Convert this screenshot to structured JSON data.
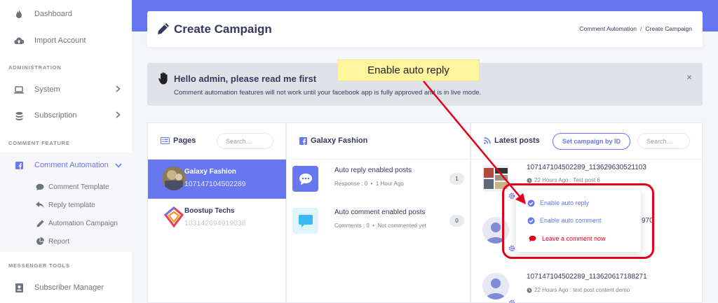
{
  "sidebar": {
    "items": [
      {
        "label": "Dashboard"
      },
      {
        "label": "Import Account"
      }
    ],
    "admin_header": "ADMINISTRATION",
    "admin_items": [
      {
        "label": "System"
      },
      {
        "label": "Subscription"
      }
    ],
    "comment_header": "COMMENT FEATURE",
    "comment_item": {
      "label": "Comment Automation"
    },
    "sub_items": [
      {
        "label": "Comment Template",
        "icon": "comment-icon"
      },
      {
        "label": "Reply template",
        "icon": "reply-icon"
      },
      {
        "label": "Automation Campaign",
        "icon": "pencil-icon"
      },
      {
        "label": "Report",
        "icon": "pie-chart-icon"
      }
    ],
    "messenger_header": "MESSENGER TOOLS",
    "messenger_items": [
      {
        "label": "Subscriber Manager"
      }
    ]
  },
  "header": {
    "title": "Create Campaign",
    "breadcrumb": [
      "Comment Automation",
      "Create Campaign"
    ],
    "breadcrumb_sep": "/"
  },
  "alert": {
    "title": "Hello admin, please read me first",
    "text": "Comment automation features will not work until your facebook app is fully approved and is in live mode.",
    "close": "×"
  },
  "callout": {
    "text": "Enable auto reply"
  },
  "pages_panel": {
    "title": "Pages",
    "search_placeholder": "Search...",
    "pages": [
      {
        "name": "Galaxy Fashion",
        "id": "107147104502289"
      },
      {
        "name": "Boostup Techs",
        "id": "103142694919038"
      }
    ]
  },
  "page_panel": {
    "title": "Galaxy Fashion",
    "items": [
      {
        "title": "Auto reply enabled posts",
        "meta_label": "Response : 0",
        "meta_time": "1 Hour Ago",
        "count": "1"
      },
      {
        "title": "Auto comment enabled posts",
        "meta_label": "Comments : 0",
        "meta_time": "Not commented yet",
        "count": "0"
      }
    ]
  },
  "posts_panel": {
    "title": "Latest posts",
    "button": "Set campaign by ID",
    "search_placeholder": "Search...",
    "posts": [
      {
        "id": "107147104502289_113629630521103",
        "time": "22 Hours Ago",
        "content": "Test post 6"
      },
      {
        "id_suffix": "970"
      },
      {
        "id": "107147104502289_113620617188271",
        "time": "22 Hours Ago",
        "content": "text post content demo"
      }
    ],
    "meta_sep": ":"
  },
  "dropdown": {
    "items": [
      {
        "label": "Enable auto reply",
        "color": "#6777ef"
      },
      {
        "label": "Enable auto comment",
        "color": "#6777ef"
      },
      {
        "label": "Leave a comment now",
        "color": "#e50019"
      }
    ]
  },
  "colors": {
    "primary": "#6777ef",
    "danger": "#e50019",
    "callout": "#fff59d"
  }
}
